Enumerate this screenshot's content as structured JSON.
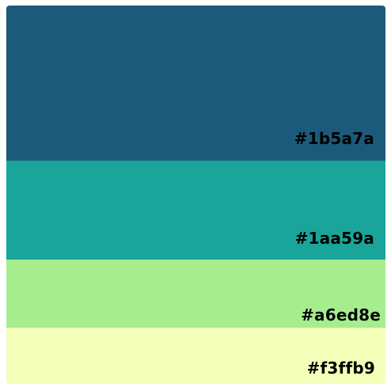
{
  "palette": {
    "swatches": [
      {
        "color": "#1b5a7a",
        "label": "#1b5a7a"
      },
      {
        "color": "#1aa59a",
        "label": "#1aa59a"
      },
      {
        "color": "#a6ed8e",
        "label": "#a6ed8e"
      },
      {
        "color": "#f3ffb9",
        "label": "#f3ffb9"
      }
    ]
  }
}
